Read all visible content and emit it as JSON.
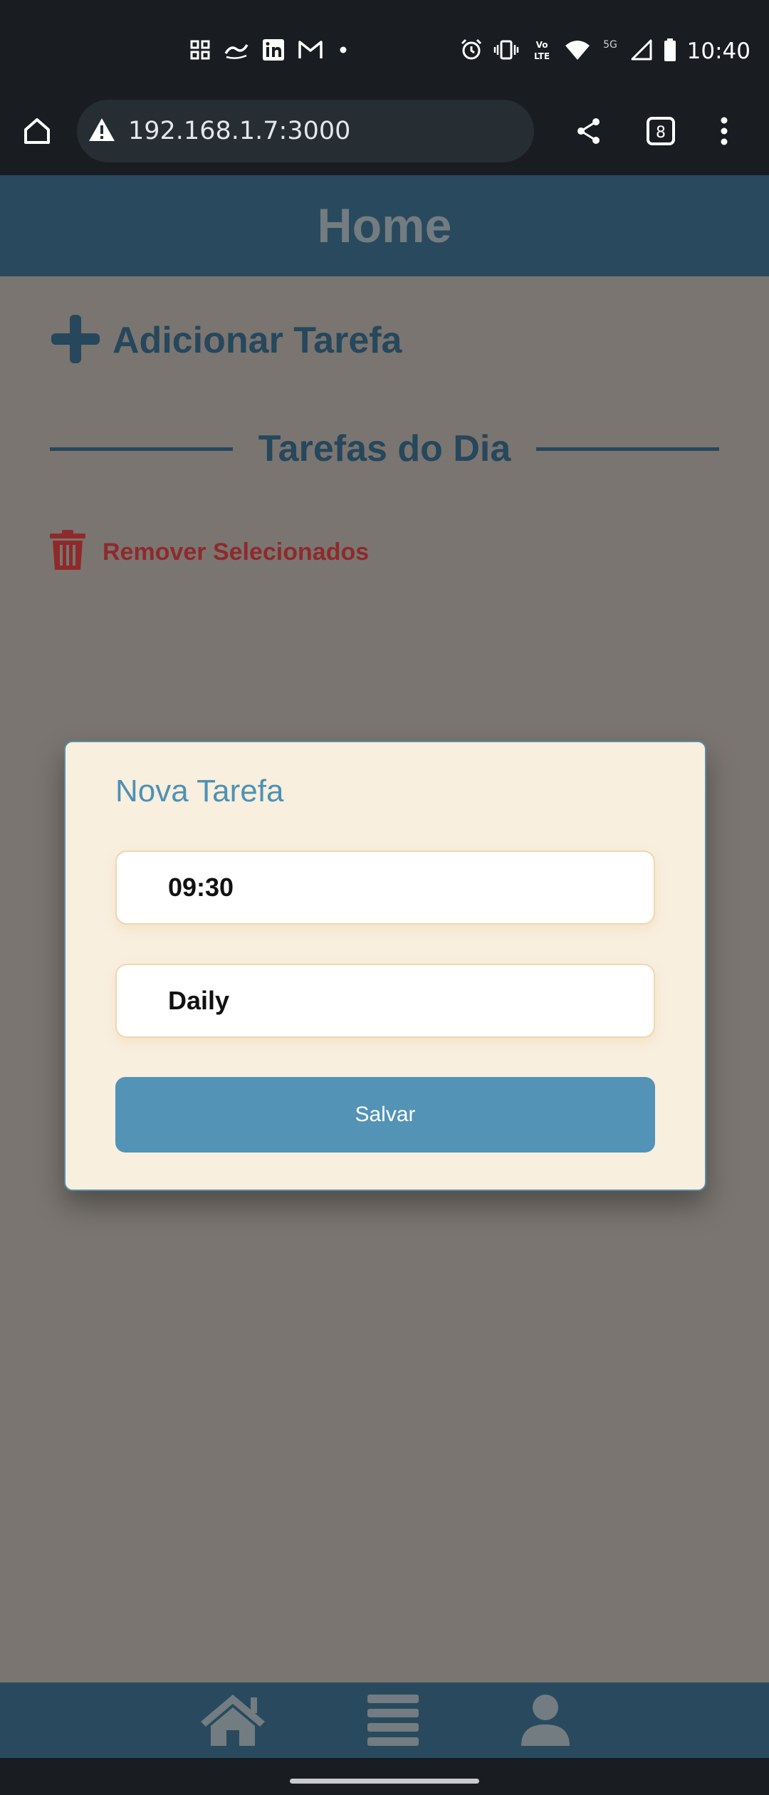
{
  "status_bar": {
    "time": "10:40",
    "left_icons": [
      "grid-icon",
      "ifood-icon",
      "linkedin-icon",
      "gmail-icon",
      "dot-icon"
    ],
    "right_icons": [
      "alarm-icon",
      "vibrate-icon",
      "volte-icon",
      "wifi-icon",
      "5g-icon",
      "signal-icon",
      "battery-icon"
    ],
    "volte_label": "Vo\nLTE",
    "network_label": "5G"
  },
  "browser": {
    "url": "192.168.1.7:3000",
    "tab_count": "8",
    "icons": [
      "home-icon",
      "warning-icon",
      "share-icon",
      "tabs-icon",
      "more-icon"
    ]
  },
  "header": {
    "title": "Home"
  },
  "main": {
    "add_task_label": "Adicionar Tarefa",
    "section_title": "Tarefas do Dia",
    "remove_selected_label": "Remover Selecionados"
  },
  "modal": {
    "title": "Nova Tarefa",
    "time_value": "09:30",
    "description_value": "Daily",
    "save_label": "Salvar"
  },
  "bottom_nav": {
    "items": [
      "home-icon",
      "list-icon",
      "profile-icon"
    ]
  },
  "colors": {
    "header_bg": "#294a5e",
    "accent_blue": "#5293b6",
    "text_dark_blue": "#26475c",
    "danger_red": "#8e2a2c",
    "modal_bg": "#f8efdf",
    "overlay_bg": "#7a7570"
  }
}
